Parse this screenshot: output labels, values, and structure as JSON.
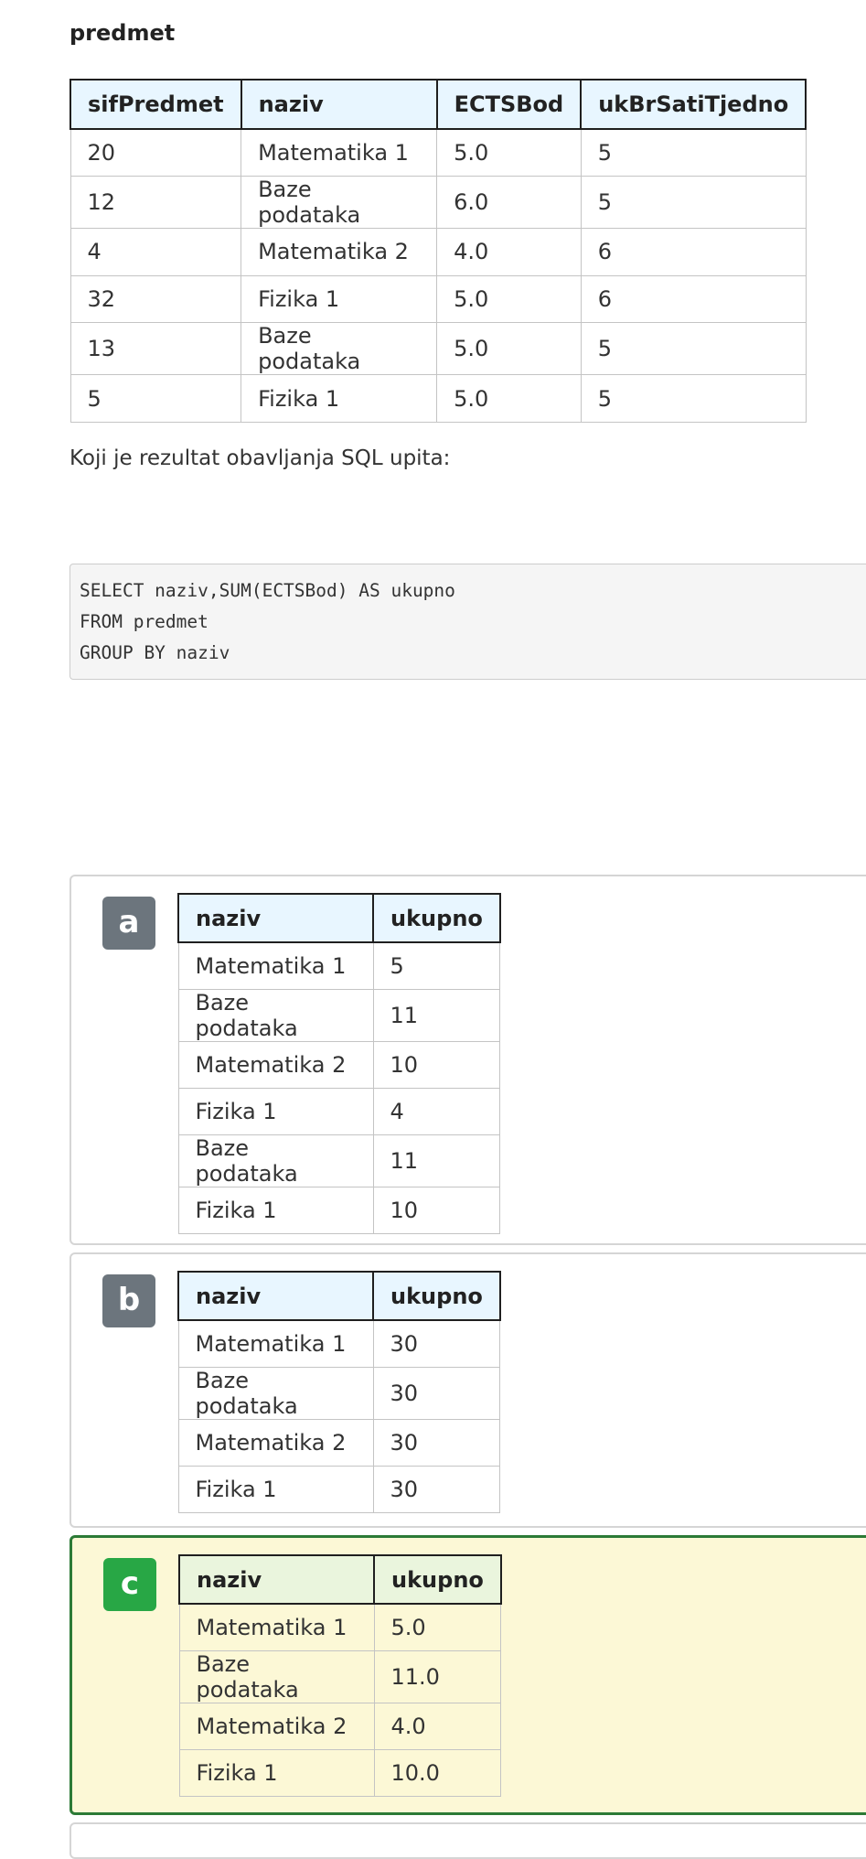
{
  "table_name": "predmet",
  "main_table": {
    "columns": [
      "sifPredmet",
      "naziv",
      "ECTSBod",
      "ukBrSatiTjedno"
    ],
    "rows": [
      [
        "20",
        "Matematika 1",
        "5.0",
        "5"
      ],
      [
        "12",
        "Baze podataka",
        "6.0",
        "5"
      ],
      [
        "4",
        "Matematika 2",
        "4.0",
        "6"
      ],
      [
        "32",
        "Fizika 1",
        "5.0",
        "6"
      ],
      [
        "13",
        "Baze podataka",
        "5.0",
        "5"
      ],
      [
        "5",
        "Fizika 1",
        "5.0",
        "5"
      ]
    ]
  },
  "question": "Koji je rezultat obavljanja SQL upita:",
  "sql": {
    "lines": [
      "SELECT naziv,SUM(ECTSBod) AS ukupno",
      "FROM predmet",
      "GROUP BY naziv"
    ]
  },
  "options": [
    {
      "letter": "a",
      "selected": false,
      "columns": [
        "naziv",
        "ukupno"
      ],
      "rows": [
        [
          "Matematika 1",
          "5"
        ],
        [
          "Baze podataka",
          "11"
        ],
        [
          "Matematika 2",
          "10"
        ],
        [
          "Fizika 1",
          "4"
        ],
        [
          "Baze podataka",
          "11"
        ],
        [
          "Fizika 1",
          "10"
        ]
      ]
    },
    {
      "letter": "b",
      "selected": false,
      "columns": [
        "naziv",
        "ukupno"
      ],
      "rows": [
        [
          "Matematika 1",
          "30"
        ],
        [
          "Baze podataka",
          "30"
        ],
        [
          "Matematika 2",
          "30"
        ],
        [
          "Fizika 1",
          "30"
        ]
      ]
    },
    {
      "letter": "c",
      "selected": true,
      "columns": [
        "naziv",
        "ukupno"
      ],
      "rows": [
        [
          "Matematika 1",
          "5.0"
        ],
        [
          "Baze podataka",
          "11.0"
        ],
        [
          "Matematika 2",
          "4.0"
        ],
        [
          "Fizika 1",
          "10.0"
        ]
      ]
    }
  ],
  "colors": {
    "header_bg": "#e8f6ff",
    "selected_bg": "#fcf8d6",
    "selected_border": "#2c7a36",
    "badge_default": "#6c757d",
    "badge_selected": "#28a745"
  }
}
